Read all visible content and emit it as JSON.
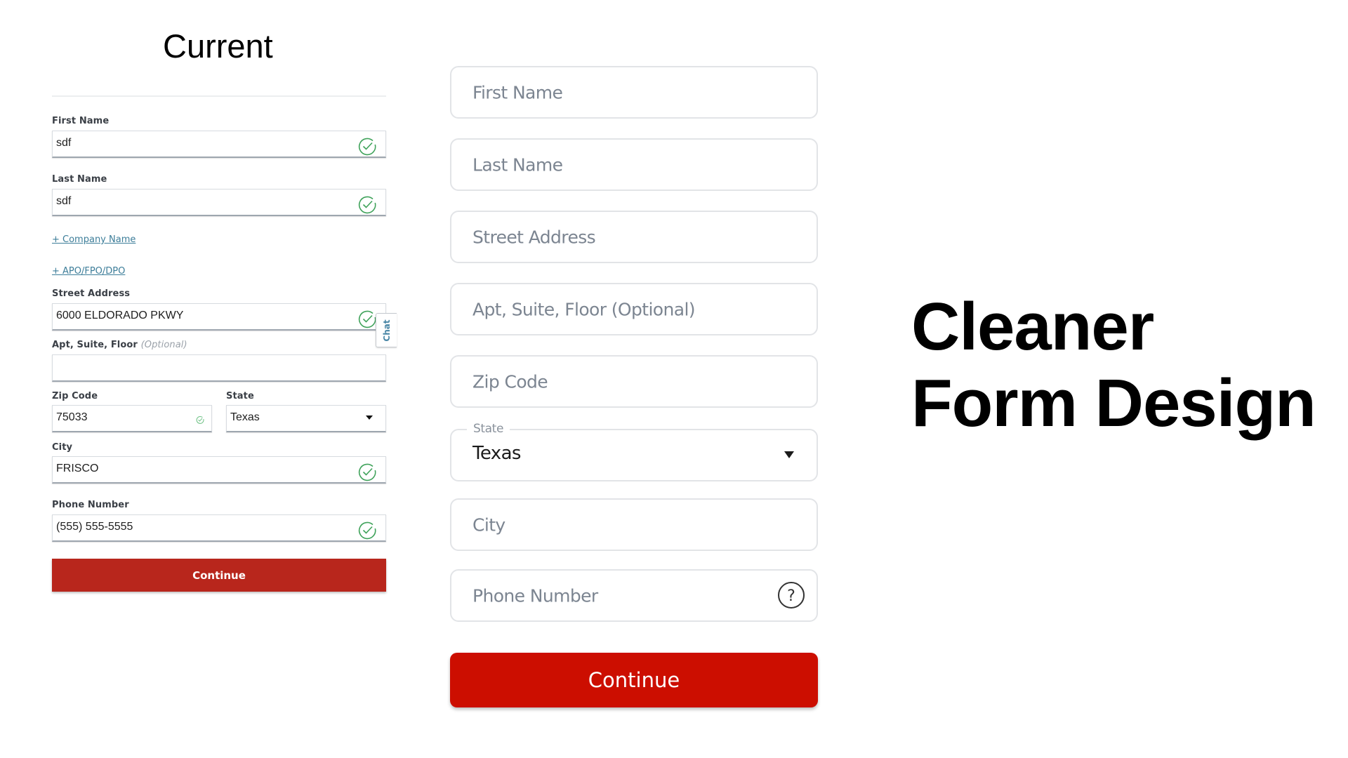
{
  "current": {
    "title": "Current",
    "fields": {
      "first_name": {
        "label": "First Name",
        "value": "sdf"
      },
      "last_name": {
        "label": "Last Name",
        "value": "sdf"
      },
      "company_link": "+ Company Name",
      "apo_link": "+ APO/FPO/DPO",
      "street": {
        "label": "Street Address",
        "value": "6000 ELDORADO PKWY"
      },
      "apt": {
        "label": "Apt, Suite, Floor",
        "optional": "(Optional)",
        "value": ""
      },
      "zip": {
        "label": "Zip Code",
        "value": "75033"
      },
      "state": {
        "label": "State",
        "value": "Texas"
      },
      "city": {
        "label": "City",
        "value": "FRISCO"
      },
      "phone": {
        "label": "Phone Number",
        "value": "(555) 555-5555"
      }
    },
    "continue_label": "Continue",
    "chat_tab_label": "Chat",
    "colors": {
      "button": "#b8261c",
      "link": "#3c7d99",
      "valid_check": "#3fa25a"
    }
  },
  "cleaner": {
    "fields": {
      "first_name": {
        "placeholder": "First Name"
      },
      "last_name": {
        "placeholder": "Last Name"
      },
      "street": {
        "placeholder": "Street Address"
      },
      "apt": {
        "placeholder": "Apt, Suite, Floor (Optional)"
      },
      "zip": {
        "placeholder": "Zip Code"
      },
      "state": {
        "label": "State",
        "value": "Texas"
      },
      "city": {
        "placeholder": "City"
      },
      "phone": {
        "placeholder": "Phone Number"
      }
    },
    "continue_label": "Continue",
    "colors": {
      "button": "#cc0e00",
      "placeholder": "#7c8591"
    }
  },
  "heading": {
    "line1": "Cleaner",
    "line2": "Form Design"
  }
}
